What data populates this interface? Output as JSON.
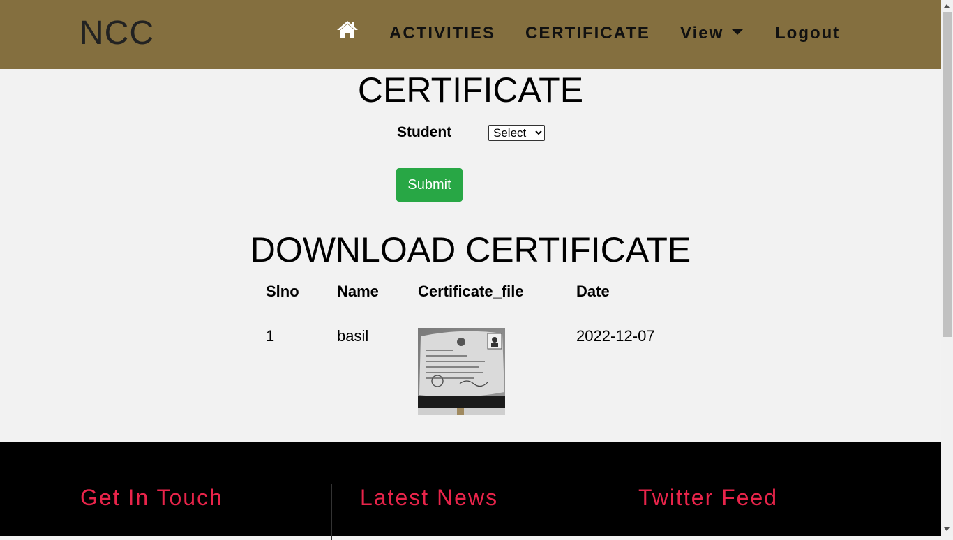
{
  "header": {
    "brand": "NCC",
    "nav": {
      "home_icon": "home-icon",
      "activities": "ACTIVITIES",
      "certificate": "CERTIFICATE",
      "view": "View",
      "logout": "Logout"
    },
    "background_color": "#846f3f"
  },
  "main": {
    "title": "CERTIFICATE",
    "form": {
      "student_label": "Student",
      "student_select_value": "Select",
      "submit_label": "Submit",
      "submit_color": "#28a745"
    },
    "download_title": "DOWNLOAD CERTIFICATE",
    "table": {
      "headers": [
        "Slno",
        "Name",
        "Certificate_file",
        "Date"
      ],
      "rows": [
        {
          "slno": "1",
          "name": "basil",
          "certificate_file": "certificate-image-thumbnail",
          "date": "2022-12-07"
        }
      ]
    }
  },
  "footer": {
    "headings": [
      "Get In Touch",
      "Latest News",
      "Twitter Feed"
    ],
    "heading_color": "#e8244a"
  }
}
